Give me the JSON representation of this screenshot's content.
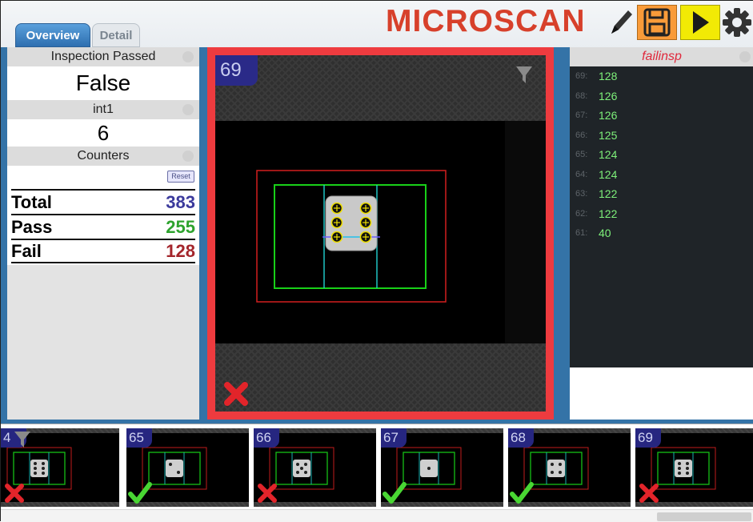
{
  "tabs": [
    {
      "label": "Overview",
      "active": true
    },
    {
      "label": "Detail",
      "active": false
    }
  ],
  "brand": {
    "logo_text": "MICROSCAN",
    "logo_color": "#d7402b"
  },
  "toolbar": {
    "edit_icon": "pencil-icon",
    "save_icon": "save-icon",
    "run_icon": "play-icon",
    "settings_icon": "gear-icon"
  },
  "left_panel": {
    "inspection_label": "Inspection Passed",
    "inspection_value": "False",
    "int_label": "int1",
    "int_value": "6",
    "counters_label": "Counters",
    "reset_label": "Reset",
    "rows": [
      {
        "label": "Total",
        "value": "383",
        "color": "#3b3a9c"
      },
      {
        "label": "Pass",
        "value": "255",
        "color": "#2ea32e"
      },
      {
        "label": "Fail",
        "value": "128",
        "color": "#a4262c"
      }
    ]
  },
  "main_image": {
    "inspection_number": "69",
    "result": "fail",
    "status_border_color": "#ee3b3f"
  },
  "right_panel": {
    "title": "failinsp",
    "items": [
      {
        "n": "69:",
        "v": "128"
      },
      {
        "n": "68:",
        "v": "126"
      },
      {
        "n": "67:",
        "v": "126"
      },
      {
        "n": "66:",
        "v": "125"
      },
      {
        "n": "65:",
        "v": "124"
      },
      {
        "n": "64:",
        "v": "124"
      },
      {
        "n": "63:",
        "v": "122"
      },
      {
        "n": "62:",
        "v": "122"
      },
      {
        "n": "61:",
        "v": "40"
      }
    ]
  },
  "thumbnails": [
    {
      "label": "4",
      "result": "fail"
    },
    {
      "label": "65",
      "result": "pass"
    },
    {
      "label": "66",
      "result": "fail"
    },
    {
      "label": "67",
      "result": "pass"
    },
    {
      "label": "68",
      "result": "pass"
    },
    {
      "label": "69",
      "result": "fail"
    }
  ]
}
